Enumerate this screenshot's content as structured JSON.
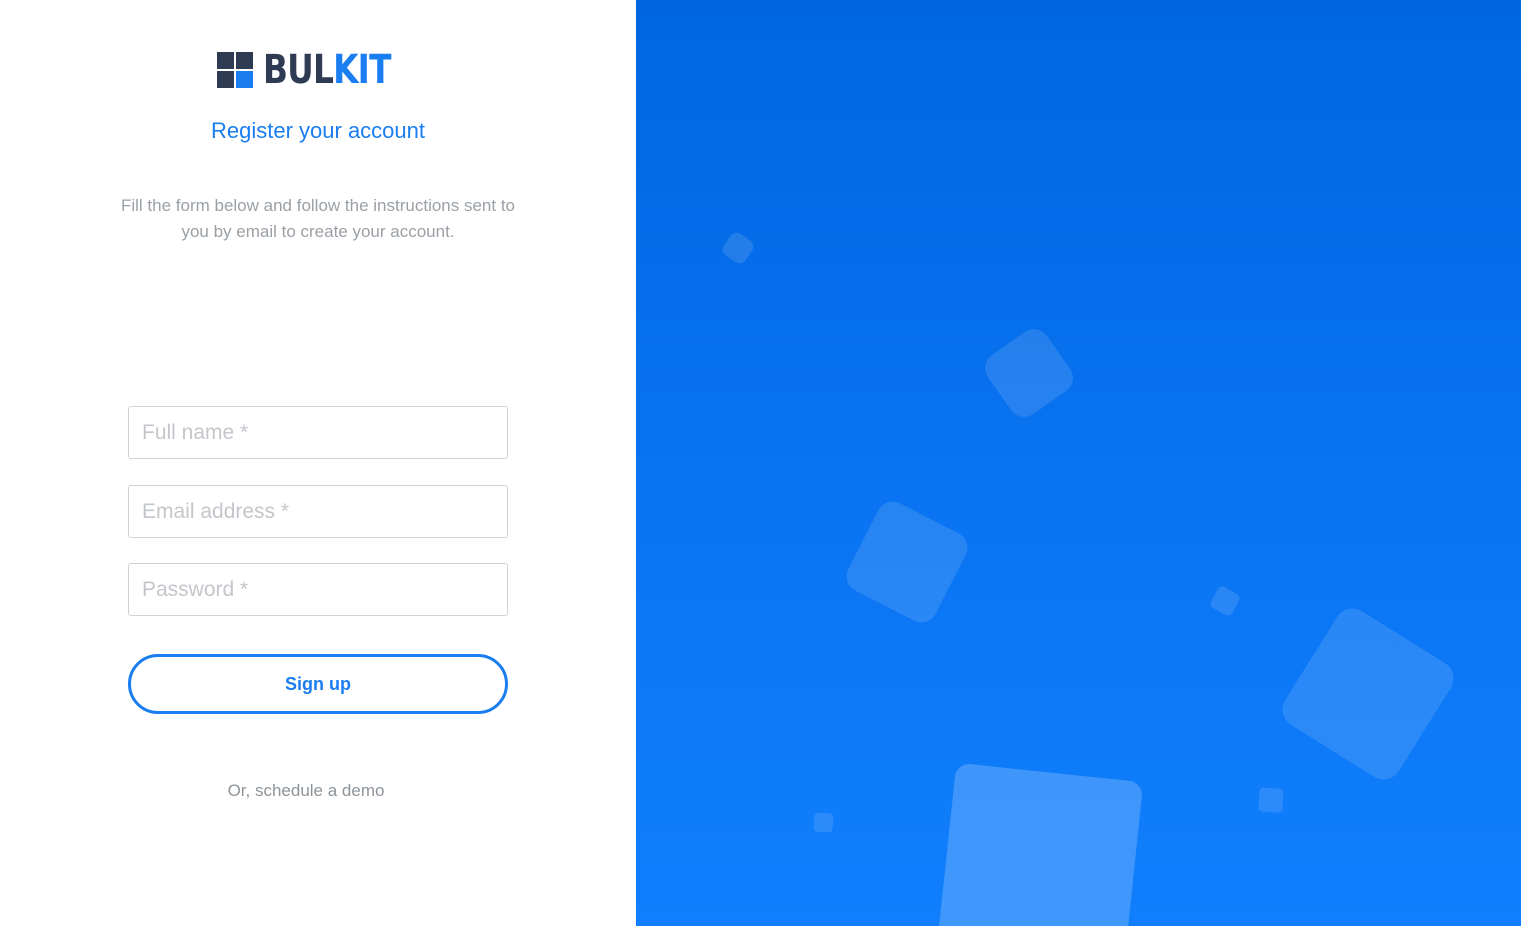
{
  "brand": {
    "name_part1": "BUL",
    "name_part2": "KIT",
    "dark_color": "#2f3b52",
    "accent_color": "#1a7ef0",
    "logo_icon": "grid-logo-icon"
  },
  "header": {
    "title": "Register your account",
    "intro": "Fill the form below and follow the instructions sent to you by email to create your account."
  },
  "form": {
    "full_name": {
      "placeholder": "Full name *",
      "value": ""
    },
    "email": {
      "placeholder": "Email address *",
      "value": ""
    },
    "password": {
      "placeholder": "Password *",
      "value": ""
    },
    "submit_label": "Sign up"
  },
  "footer": {
    "demo_link": "Or, schedule a demo"
  },
  "hero": {
    "background_top": "#0066e0",
    "background_bottom": "#117ffd"
  }
}
